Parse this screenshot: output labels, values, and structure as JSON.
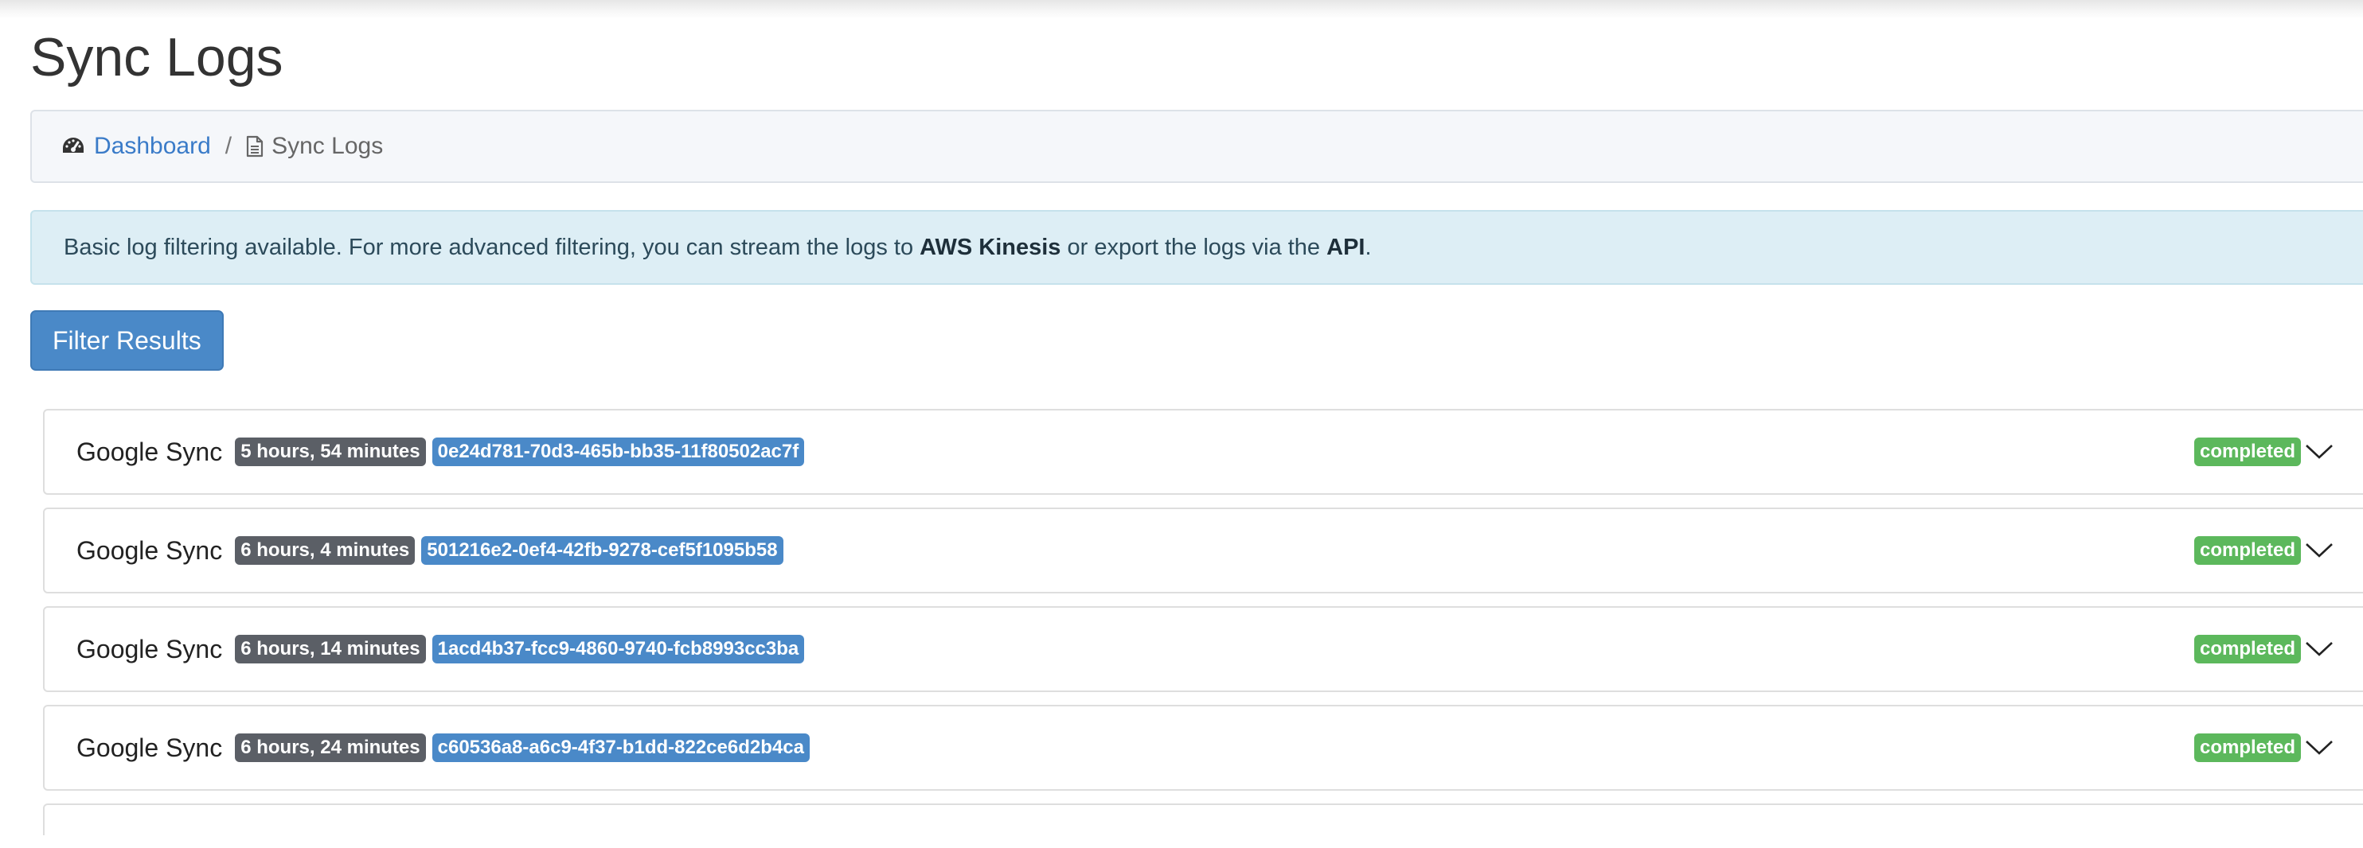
{
  "page": {
    "title": "Sync Logs"
  },
  "breadcrumb": {
    "home_icon": "tachometer-icon",
    "home_label": "Dashboard",
    "separator": "/",
    "current_icon": "file-icon",
    "current_label": "Sync Logs"
  },
  "alert": {
    "text_before": "Basic log filtering available. For more advanced filtering, you can stream the logs to ",
    "kinesis": "AWS Kinesis",
    "text_middle": " or export the logs via the ",
    "api": "API",
    "text_after": "."
  },
  "filter_button": {
    "label": "Filter Results"
  },
  "logs": [
    {
      "name": "Google Sync",
      "duration": "5 hours, 54 minutes",
      "id": "0e24d781-70d3-465b-bb35-11f80502ac7f",
      "status": "completed"
    },
    {
      "name": "Google Sync",
      "duration": "6 hours, 4 minutes",
      "id": "501216e2-0ef4-42fb-9278-cef5f1095b58",
      "status": "completed"
    },
    {
      "name": "Google Sync",
      "duration": "6 hours, 14 minutes",
      "id": "1acd4b37-fcc9-4860-9740-fcb8993cc3ba",
      "status": "completed"
    },
    {
      "name": "Google Sync",
      "duration": "6 hours, 24 minutes",
      "id": "c60536a8-a6c9-4f37-b1dd-822ce6d2b4ca",
      "status": "completed"
    }
  ],
  "colors": {
    "primary": "#4a89c8",
    "success": "#5cb85c",
    "dark_badge": "#5b5f66",
    "alert_bg": "#ddeef5"
  }
}
